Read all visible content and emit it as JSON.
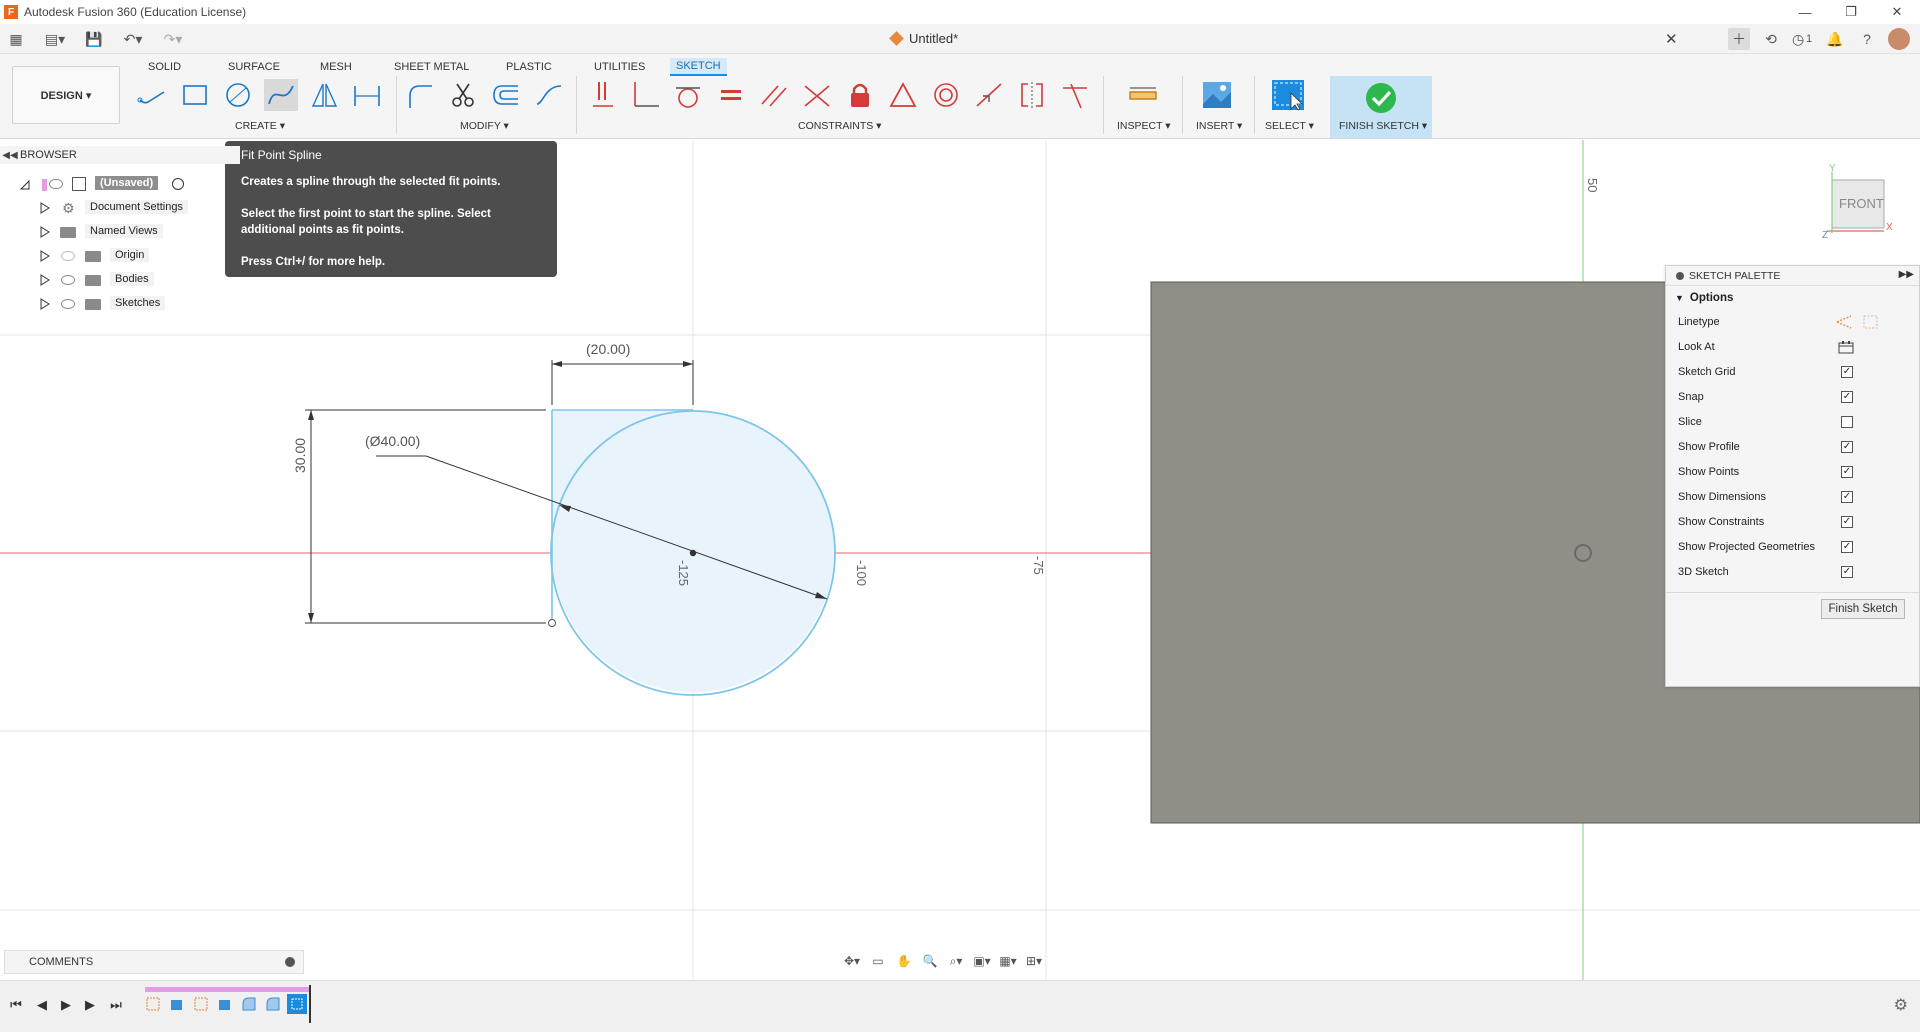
{
  "window": {
    "title": "Autodesk Fusion 360 (Education License)",
    "logo_letter": "F",
    "controls": [
      "—",
      "❐",
      "✕"
    ]
  },
  "doc_tab": {
    "title": "Untitled*",
    "close": "✕"
  },
  "top_right": {
    "job_count": "1"
  },
  "workspace": {
    "label": "DESIGN ▾"
  },
  "tabs": [
    {
      "label": "SOLID"
    },
    {
      "label": "SURFACE"
    },
    {
      "label": "MESH"
    },
    {
      "label": "SHEET METAL"
    },
    {
      "label": "PLASTIC"
    },
    {
      "label": "UTILITIES"
    },
    {
      "label": "SKETCH"
    }
  ],
  "groups": {
    "create": "CREATE ▾",
    "modify": "MODIFY ▾",
    "constraints": "CONSTRAINTS ▾",
    "inspect": "INSPECT ▾",
    "insert": "INSERT ▾",
    "select": "SELECT ▾",
    "finish": "FINISH SKETCH ▾"
  },
  "tooltip": {
    "title": "Fit Point Spline",
    "line1": "Creates a spline through the selected fit points.",
    "line2": "Select the first point to start the spline. Select additional points as fit points.",
    "line3": "Press Ctrl+/ for more help."
  },
  "browser": {
    "title": "BROWSER",
    "root": "(Unsaved)",
    "items": [
      {
        "label": "Document Settings"
      },
      {
        "label": "Named Views"
      },
      {
        "label": "Origin"
      },
      {
        "label": "Bodies"
      },
      {
        "label": "Sketches"
      }
    ]
  },
  "sketch": {
    "dim_width": "(20.00)",
    "dim_height": "30.00",
    "dim_diameter": "(Ø40.00)",
    "axis_labels": [
      "-125",
      "-100",
      "-75",
      "50"
    ]
  },
  "viewcube": {
    "face": "FRONT",
    "x": "X",
    "y": "Y",
    "z": "Z"
  },
  "palette": {
    "title": "SKETCH PALETTE",
    "section": "Options",
    "options": [
      {
        "label": "Linetype",
        "type": "icon"
      },
      {
        "label": "Look At",
        "type": "icon"
      },
      {
        "label": "Sketch Grid",
        "checked": true
      },
      {
        "label": "Snap",
        "checked": true
      },
      {
        "label": "Slice",
        "checked": false
      },
      {
        "label": "Show Profile",
        "checked": true
      },
      {
        "label": "Show Points",
        "checked": true
      },
      {
        "label": "Show Dimensions",
        "checked": true
      },
      {
        "label": "Show Constraints",
        "checked": true
      },
      {
        "label": "Show Projected Geometries",
        "checked": true
      },
      {
        "label": "3D Sketch",
        "checked": true
      }
    ],
    "finish_button": "Finish Sketch"
  },
  "comments": {
    "label": "COMMENTS"
  },
  "colors": {
    "accent": "#1b8be0",
    "finish_green": "#2db84d",
    "sketch_blue": "#7cc6ea",
    "profile_fill": "#e8f3fb",
    "panel_gray": "#8f8e87",
    "x_axis": "#e06666",
    "y_axis": "#7fd17f"
  }
}
